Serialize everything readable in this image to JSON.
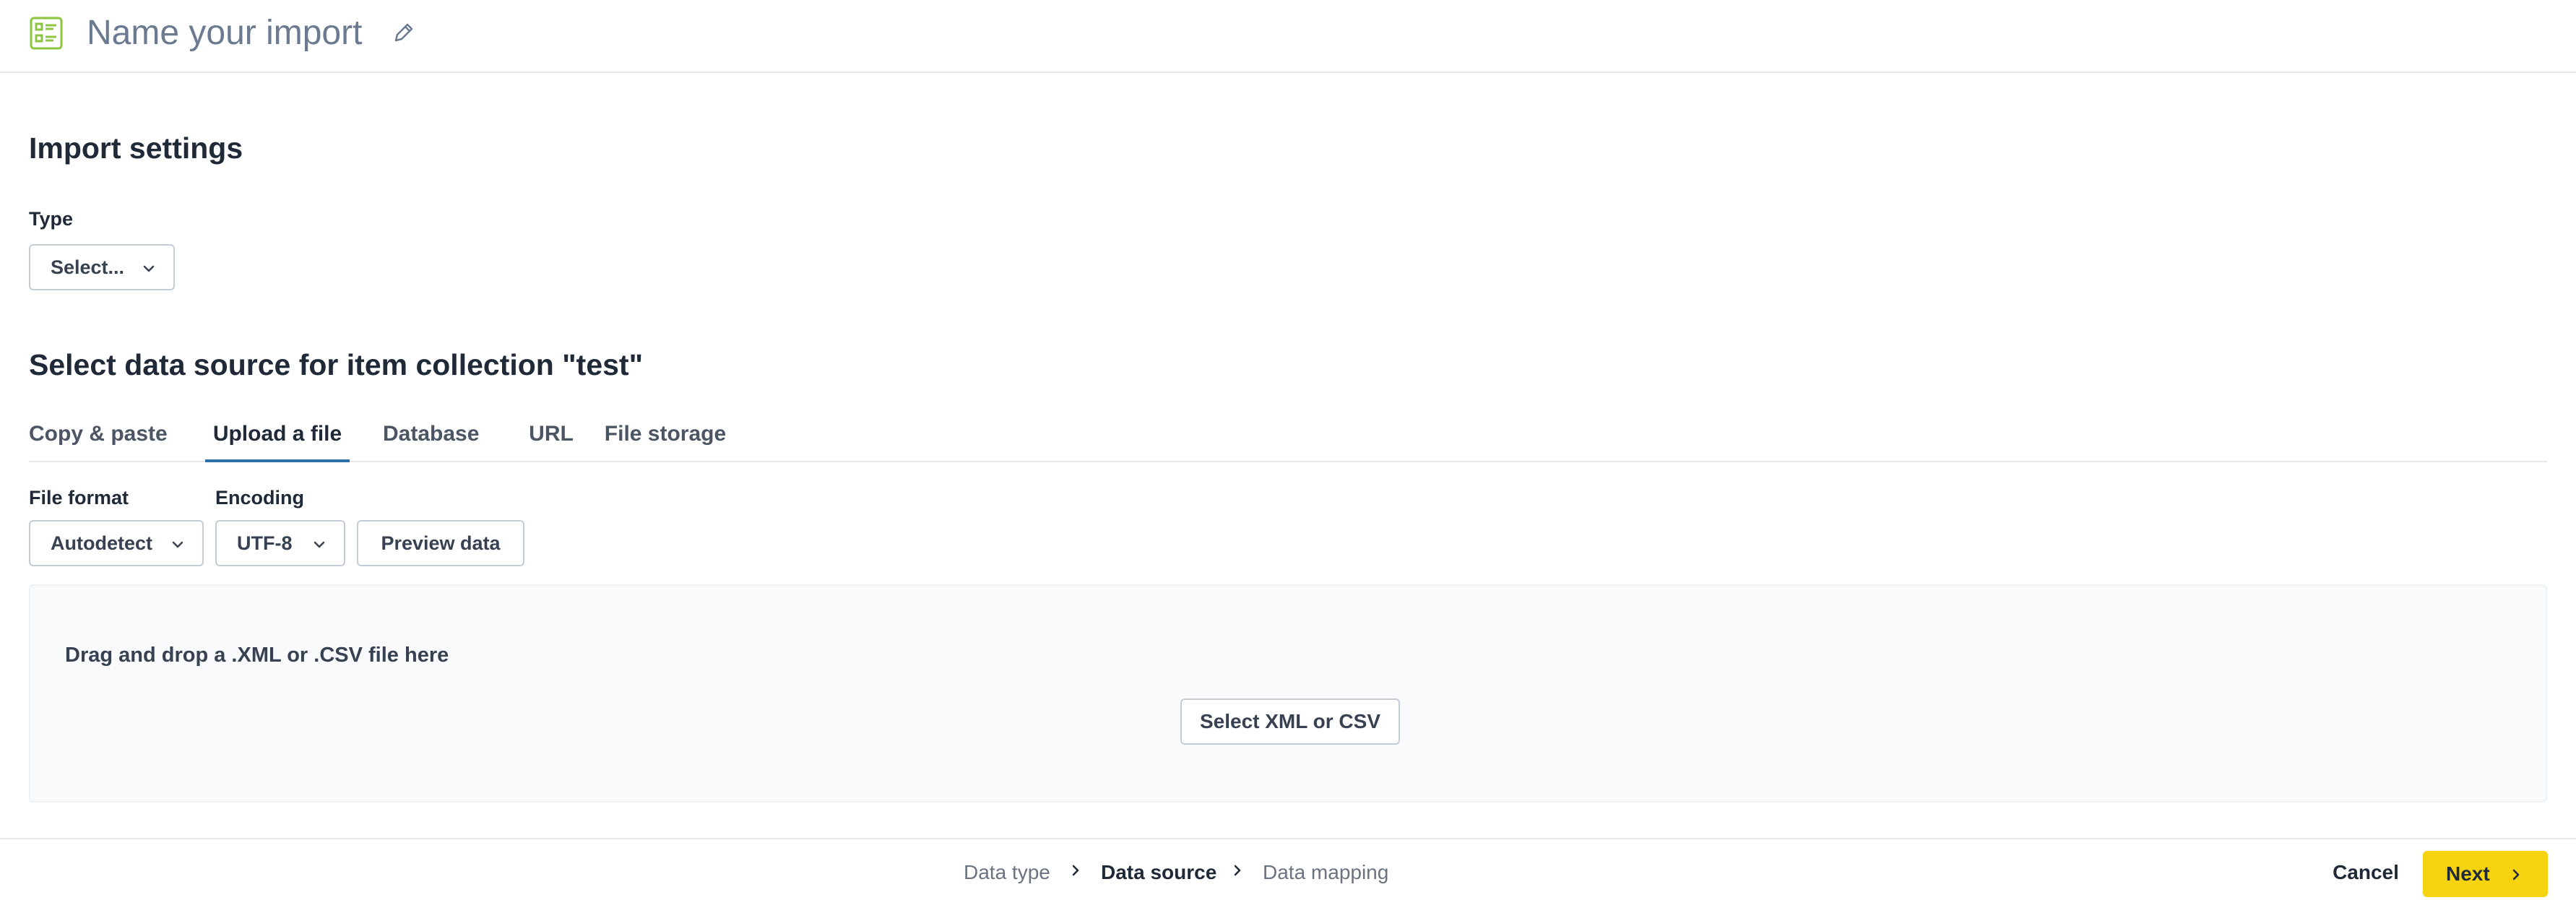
{
  "header": {
    "title": "Name your import",
    "icon": "list-document-icon",
    "edit_icon": "pencil-icon",
    "accent_color": "#8cc63f"
  },
  "import_settings": {
    "title": "Import settings",
    "type_label": "Type",
    "type_value": "Select..."
  },
  "data_source": {
    "title": "Select data source for item collection \"test\"",
    "tabs": [
      {
        "label": "Copy & paste",
        "active": false
      },
      {
        "label": "Upload a file",
        "active": true
      },
      {
        "label": "Database",
        "active": false
      },
      {
        "label": "URL",
        "active": false
      },
      {
        "label": "File storage",
        "active": false
      }
    ],
    "file_format_label": "File format",
    "file_format_value": "Autodetect",
    "encoding_label": "Encoding",
    "encoding_value": "UTF-8",
    "preview_button": "Preview data",
    "dropzone_text": "Drag and drop a .XML or .CSV file here",
    "select_button": "Select XML or CSV",
    "tab_active_color": "#2f6fa8"
  },
  "footer": {
    "steps": [
      {
        "label": "Data type",
        "active": false
      },
      {
        "label": "Data source",
        "active": true
      },
      {
        "label": "Data mapping",
        "active": false
      }
    ],
    "cancel_label": "Cancel",
    "next_label": "Next",
    "next_color": "#f5d40f"
  }
}
